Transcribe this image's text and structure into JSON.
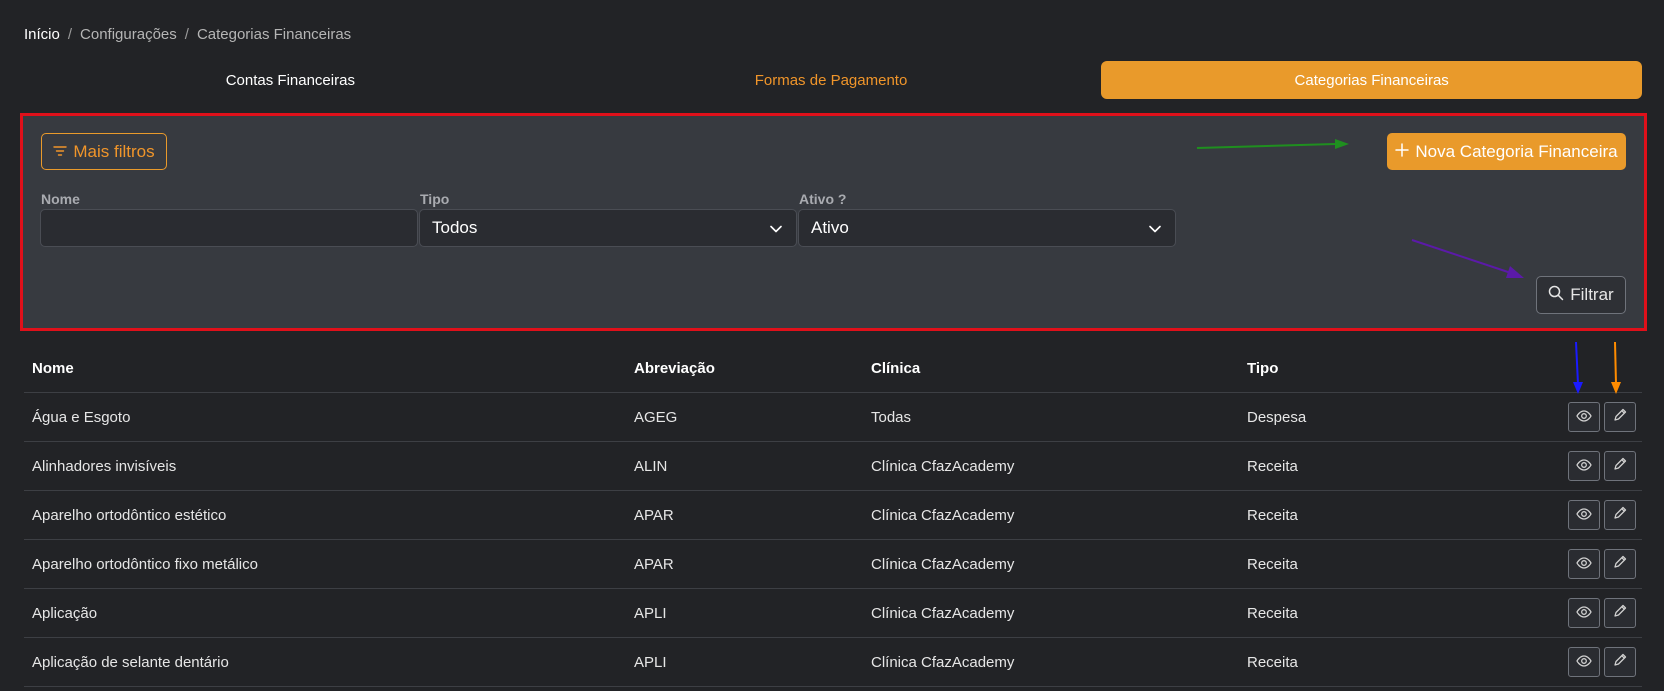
{
  "breadcrumb": {
    "home": "Início",
    "sep": "/",
    "config": "Configurações",
    "current": "Categorias Financeiras"
  },
  "tabs": [
    {
      "label": "Contas Financeiras",
      "state": "default"
    },
    {
      "label": "Formas de Pagamento",
      "state": "highlight"
    },
    {
      "label": "Categorias Financeiras",
      "state": "active"
    }
  ],
  "filters": {
    "more_label": "Mais filtros",
    "new_label": "Nova Categoria Financeira",
    "nome_label": "Nome",
    "nome_value": "",
    "tipo_label": "Tipo",
    "tipo_value": "Todos",
    "ativo_label": "Ativo ?",
    "ativo_value": "Ativo",
    "filter_label": "Filtrar"
  },
  "table": {
    "headers": {
      "nome": "Nome",
      "abreviacao": "Abreviação",
      "clinica": "Clínica",
      "tipo": "Tipo"
    },
    "rows": [
      {
        "nome": "Água e Esgoto",
        "abreviacao": "AGEG",
        "clinica": "Todas",
        "tipo": "Despesa"
      },
      {
        "nome": "Alinhadores invisíveis",
        "abreviacao": "ALIN",
        "clinica": "Clínica CfazAcademy",
        "tipo": "Receita"
      },
      {
        "nome": "Aparelho ortodôntico estético",
        "abreviacao": "APAR",
        "clinica": "Clínica CfazAcademy",
        "tipo": "Receita"
      },
      {
        "nome": "Aparelho ortodôntico fixo metálico",
        "abreviacao": "APAR",
        "clinica": "Clínica CfazAcademy",
        "tipo": "Receita"
      },
      {
        "nome": "Aplicação",
        "abreviacao": "APLI",
        "clinica": "Clínica CfazAcademy",
        "tipo": "Receita"
      },
      {
        "nome": "Aplicação de selante dentário",
        "abreviacao": "APLI",
        "clinica": "Clínica CfazAcademy",
        "tipo": "Receita"
      }
    ]
  },
  "colors": {
    "accent": "#e99a2b",
    "highlight_border": "#e0101a",
    "arrow_green": "#1f8f1f",
    "arrow_purple": "#5b1aa8",
    "arrow_blue": "#1a1aff",
    "arrow_orange": "#ff8c00"
  },
  "icons": {
    "more": "filter-lines-icon",
    "new": "plus-icon",
    "select": "chevron-down-icon",
    "filter": "search-icon",
    "view": "eye-icon",
    "edit": "pencil-icon"
  }
}
